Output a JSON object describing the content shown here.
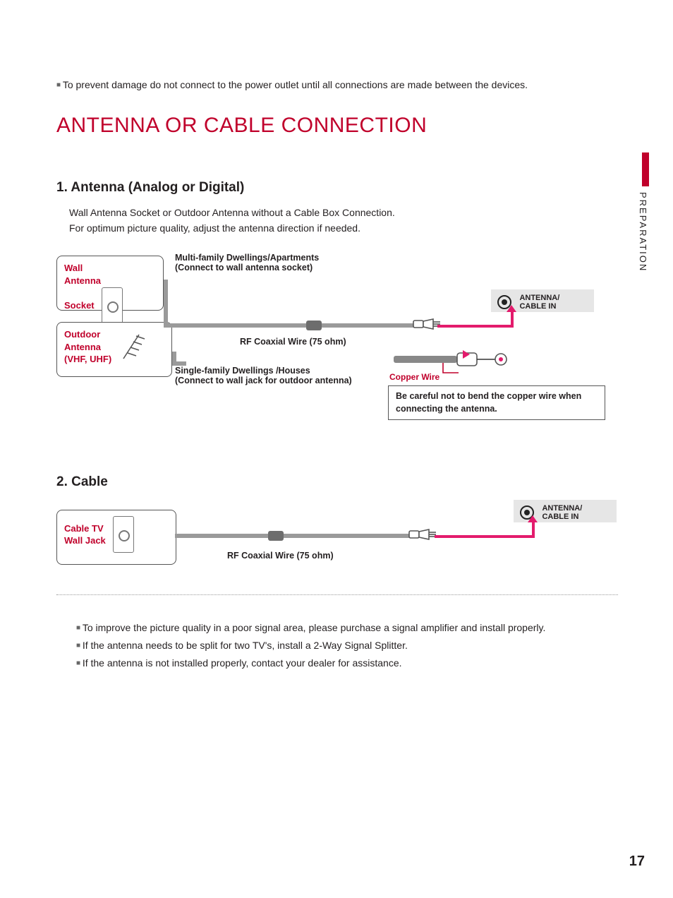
{
  "pageNumber": "17",
  "sideTab": "PREPARATION",
  "topNote": "To prevent damage do not connect to the power outlet until all connections are made between the devices.",
  "title": "ANTENNA OR CABLE CONNECTION",
  "section1": {
    "heading": "1. Antenna (Analog or Digital)",
    "para1": "Wall Antenna Socket or Outdoor Antenna without a Cable Box Connection.",
    "para2": "For optimum picture quality, adjust the antenna direction if needed.",
    "wallSocket": "Wall\nAntenna\nSocket",
    "outdoor": "Outdoor\nAntenna\n(VHF, UHF)",
    "multiFamily": "Multi-family Dwellings/Apartments\n(Connect to wall antenna socket)",
    "singleFamily": "Single-family Dwellings /Houses\n(Connect to wall jack for outdoor antenna)",
    "rfLabel": "RF Coaxial Wire (75 ohm)",
    "copperWire": "Copper Wire",
    "bendWarning": "Be careful not to bend the copper wire when connecting the antenna.",
    "portLabel": "ANTENNA/\nCABLE IN"
  },
  "section2": {
    "heading": "2. Cable",
    "cableJack": "Cable TV\nWall Jack",
    "rfLabel": "RF Coaxial Wire (75 ohm)",
    "portLabel": "ANTENNA/\nCABLE IN"
  },
  "notes": {
    "n1": "To improve the picture quality in a poor signal area, please purchase a signal amplifier and install properly.",
    "n2": "If the antenna needs to be split for two TV's, install a 2-Way Signal Splitter.",
    "n3": "If the antenna is not installed properly, contact your dealer for assistance."
  }
}
